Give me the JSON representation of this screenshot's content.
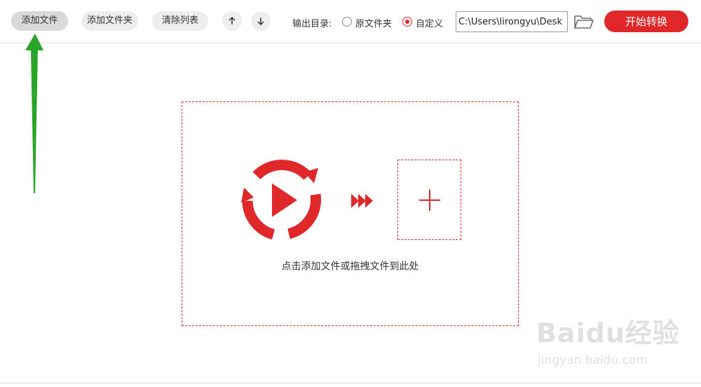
{
  "toolbar": {
    "add_file": "添加文件",
    "add_folder": "添加文件夹",
    "clear_list": "清除列表",
    "output_dir_label": "输出目录:",
    "option_original": "原文件夹",
    "option_custom": "自定义",
    "selected_option": "自定义",
    "output_path": "C:\\Users\\lirongyu\\Desk",
    "start_label": "开始转换"
  },
  "dropzone": {
    "hint": "点击添加文件或拖拽文件到此处"
  },
  "watermark": {
    "logo": "Baidu经验",
    "url": "jingyan.baidu.com"
  },
  "colors": {
    "accent": "#e0282a",
    "annotation_arrow": "#2aa52a"
  },
  "icons": [
    "arrow-up-icon",
    "arrow-down-icon",
    "folder-open-icon",
    "video-convert-icon",
    "fast-forward-icon",
    "plus-icon"
  ]
}
